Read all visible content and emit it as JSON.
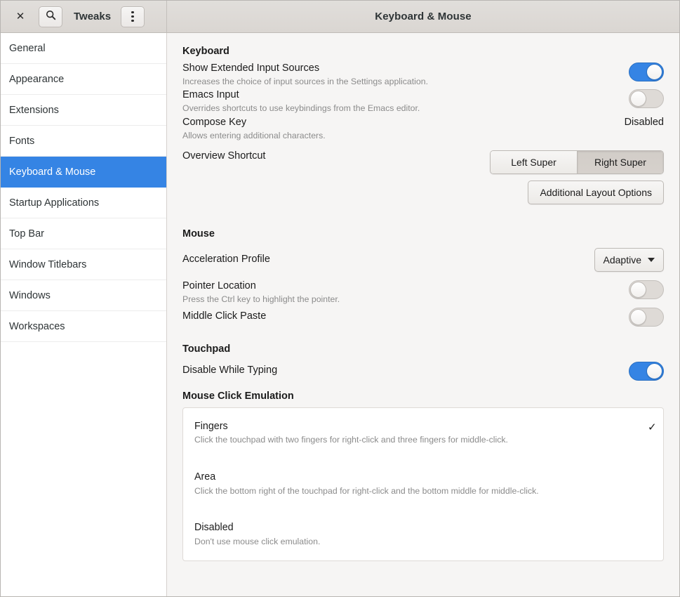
{
  "window": {
    "title": "Keyboard & Mouse",
    "app_name": "Tweaks",
    "close_icon": "close-icon",
    "search_icon": "search-icon",
    "menu_icon": "menu-dots-icon"
  },
  "sidebar": {
    "items": [
      {
        "label": "General",
        "selected": false
      },
      {
        "label": "Appearance",
        "selected": false
      },
      {
        "label": "Extensions",
        "selected": false
      },
      {
        "label": "Fonts",
        "selected": false
      },
      {
        "label": "Keyboard & Mouse",
        "selected": true
      },
      {
        "label": "Startup Applications",
        "selected": false
      },
      {
        "label": "Top Bar",
        "selected": false
      },
      {
        "label": "Window Titlebars",
        "selected": false
      },
      {
        "label": "Windows",
        "selected": false
      },
      {
        "label": "Workspaces",
        "selected": false
      }
    ]
  },
  "keyboard": {
    "heading": "Keyboard",
    "extended_input": {
      "label": "Show Extended Input Sources",
      "desc": "Increases the choice of input sources in the Settings application.",
      "state": "on"
    },
    "emacs_input": {
      "label": "Emacs Input",
      "desc": "Overrides shortcuts to use keybindings from the Emacs editor.",
      "state": "off"
    },
    "compose_key": {
      "label": "Compose Key",
      "desc": "Allows entering additional characters.",
      "value": "Disabled"
    },
    "overview_shortcut": {
      "label": "Overview Shortcut",
      "options": [
        "Left Super",
        "Right Super"
      ],
      "selected": "Right Super"
    },
    "additional_layout": "Additional Layout Options"
  },
  "mouse": {
    "heading": "Mouse",
    "acceleration_profile": {
      "label": "Acceleration Profile",
      "value": "Adaptive"
    },
    "pointer_location": {
      "label": "Pointer Location",
      "desc": "Press the Ctrl key to highlight the pointer.",
      "state": "off"
    },
    "middle_click_paste": {
      "label": "Middle Click Paste",
      "desc": "",
      "state": "off"
    }
  },
  "touchpad": {
    "heading": "Touchpad",
    "disable_while_typing": {
      "label": "Disable While Typing",
      "state": "on"
    },
    "mouse_click_emulation": {
      "heading": "Mouse Click Emulation",
      "options": [
        {
          "title": "Fingers",
          "desc": "Click the touchpad with two fingers for right-click and three fingers for middle-click.",
          "check": "✓"
        },
        {
          "title": "Area",
          "desc": "Click the bottom right of the touchpad for right-click and the bottom middle for middle-click.",
          "check": ""
        },
        {
          "title": "Disabled",
          "desc": "Don't use mouse click emulation.",
          "check": ""
        }
      ]
    }
  },
  "colors": {
    "accent": "#3584e4",
    "selection": "#3584e4",
    "content_bg": "#f6f5f4",
    "header_bg": "#dad6d2"
  }
}
